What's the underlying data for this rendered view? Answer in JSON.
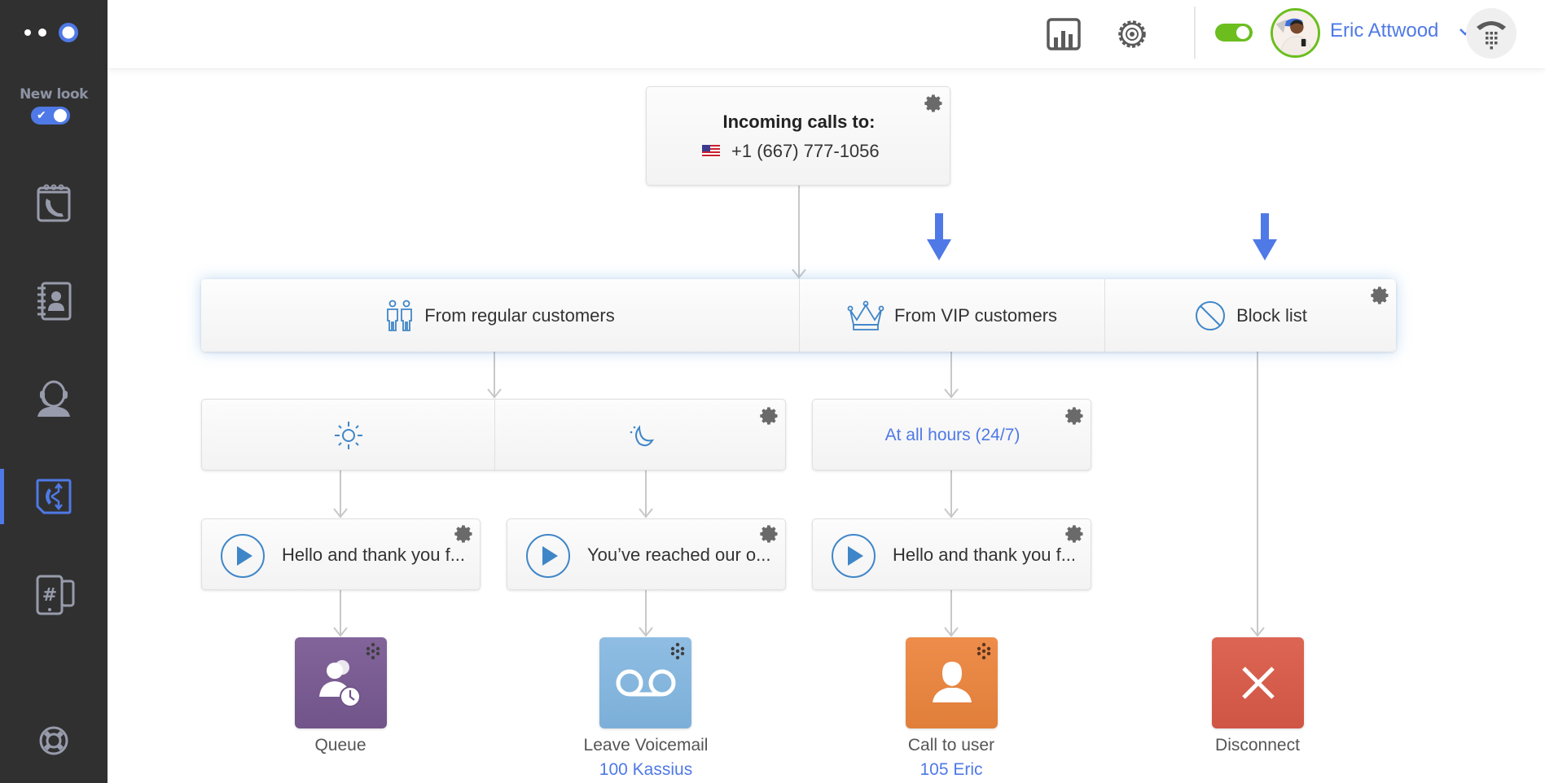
{
  "sidebar": {
    "new_look_label": "New look",
    "new_look_enabled": true,
    "nav_items": [
      {
        "id": "call-history",
        "icon": "calendar-phone-icon",
        "active": false
      },
      {
        "id": "contacts",
        "icon": "address-book-icon",
        "active": false
      },
      {
        "id": "agents",
        "icon": "operator-headset-icon",
        "active": false
      },
      {
        "id": "call-routing",
        "icon": "call-routing-icon",
        "active": true
      },
      {
        "id": "numbers",
        "icon": "phone-numbers-icon",
        "active": false
      },
      {
        "id": "help",
        "icon": "lifebuoy-icon",
        "active": false
      }
    ]
  },
  "header": {
    "analytics_icon": "bar-chart-icon",
    "settings_icon": "gear-icon",
    "status_online": true,
    "user_name": "Eric Attwood",
    "dialpad_icon": "dialpad-phone-icon"
  },
  "flow": {
    "incoming": {
      "title": "Incoming calls to:",
      "flag": "US",
      "number": "+1 (667) 777-1056"
    },
    "branches": [
      {
        "label": "From regular customers",
        "icon": "people-icon"
      },
      {
        "label": "From VIP customers",
        "icon": "crown-icon"
      },
      {
        "label": "Block list",
        "icon": "block-icon"
      }
    ],
    "schedules": {
      "regular": [
        {
          "icon": "sun-icon",
          "name": "business-hours"
        },
        {
          "icon": "moon-icon",
          "name": "after-hours"
        }
      ],
      "vip": {
        "label": "At all hours (24/7)"
      }
    },
    "greetings": [
      {
        "label": "Hello and thank you f..."
      },
      {
        "label": "You’ve reached our o..."
      },
      {
        "label": "Hello and thank you f..."
      }
    ],
    "actions": [
      {
        "label": "Queue",
        "sub": "",
        "color": "#7b5c93",
        "icon": "queue-icon"
      },
      {
        "label": "Leave Voicemail",
        "sub": "100 Kassius",
        "color": "#88b7dd",
        "icon": "voicemail-icon"
      },
      {
        "label": "Call to user",
        "sub": "105 Eric",
        "color": "#e8843f",
        "icon": "user-icon"
      },
      {
        "label": "Disconnect",
        "sub": "",
        "color": "#d95b4b",
        "icon": "close-icon"
      }
    ]
  },
  "colors": {
    "accent": "#4f79e6",
    "online": "#6bbe1e",
    "sidebar_bg": "#303030",
    "icon_blue": "#3f86c8"
  }
}
